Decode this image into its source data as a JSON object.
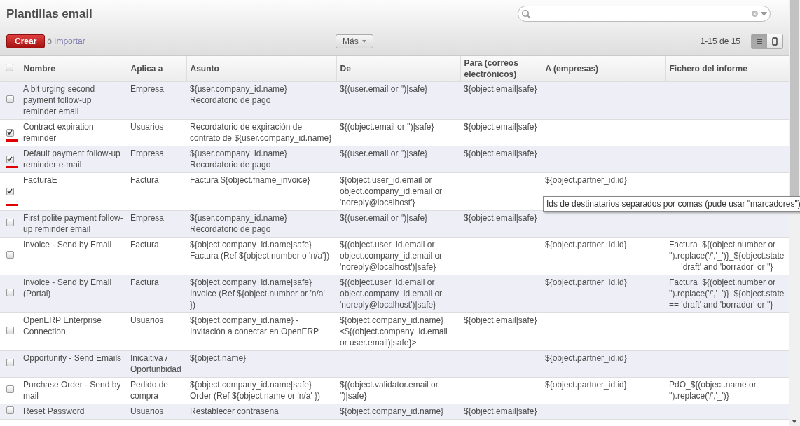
{
  "title": "Plantillas email",
  "select_all": false,
  "toolbar": {
    "create": "Crear",
    "or_import": "ó",
    "import": "Importar",
    "more": "Más",
    "pager": "1-15 de 15",
    "views": [
      {
        "kind": "list",
        "selected": true
      },
      {
        "kind": "form",
        "selected": false
      }
    ]
  },
  "table": {
    "columns": [
      "Nombre",
      "Aplica a",
      "Asunto",
      "De",
      "Para (correos electrónicos)",
      "A (empresas)",
      "Fichero del informe"
    ],
    "rows": [
      {
        "checked": false,
        "cells": [
          "A bit urging second payment follow-up reminder email",
          "Empresa",
          "${user.company_id.name} Recordatorio de pago",
          "${(user.email or '')|safe}",
          "${object.email|safe}",
          "",
          ""
        ]
      },
      {
        "checked": true,
        "cells": [
          "Contract expiration reminder",
          "Usuarios",
          "Recordatorio de expiración de contrato de ${user.company_id.name}",
          "${(object.email or '')|safe}",
          "${object.email|safe}",
          "",
          ""
        ]
      },
      {
        "checked": true,
        "cells": [
          "Default payment follow-up reminder e-mail",
          "Empresa",
          "${user.company_id.name} Recordatorio de pago",
          "${(user.email or '')|safe}",
          "${object.email|safe}",
          "",
          ""
        ]
      },
      {
        "checked": true,
        "cells": [
          "FacturaE",
          "Factura",
          "Factura ${object.fname_invoice}",
          "${object.user_id.email or object.company_id.email or 'noreply@localhost'}",
          "",
          "${object.partner_id.id}",
          ""
        ]
      },
      {
        "checked": false,
        "cells": [
          "First polite payment follow-up reminder email",
          "Empresa",
          "${user.company_id.name} Recordatorio de pago",
          "${(user.email or '')|safe}",
          "${object.email|safe}",
          "",
          ""
        ]
      },
      {
        "checked": false,
        "cells": [
          "Invoice - Send by Email",
          "Factura",
          "${object.company_id.name|safe} Factura (Ref ${object.number o 'n/a'})",
          "${(object.user_id.email or object.company_id.email or 'noreply@localhost')|safe}",
          "",
          "${object.partner_id.id}",
          "Factura_${(object.number or '').replace('/','_')}_${object.state == 'draft' and 'borrador' or ''}"
        ]
      },
      {
        "checked": false,
        "cells": [
          "Invoice - Send by Email (Portal)",
          "Factura",
          "${object.company_id.name|safe} Invoice (Ref ${object.number or 'n/a' })",
          "${(object.user_id.email or object.company_id.email or 'noreply@localhost')|safe}",
          "",
          "${object.partner_id.id}",
          "Factura_${(object.number or '').replace('/','_')}_${object.state == 'draft' and 'borrador' or ''}"
        ]
      },
      {
        "checked": false,
        "cells": [
          "OpenERP Enterprise Connection",
          "Usuarios",
          "${object.company_id.name} - Invitación a conectar en OpenERP",
          "${object.company_id.name} <${(object.company_id.email or user.email)|safe}>",
          "${object.email|safe}",
          "",
          ""
        ]
      },
      {
        "checked": false,
        "cells": [
          "Opportunity - Send Emails",
          "Inicaitiva / Oportunbidad",
          "${object.name}",
          "",
          "",
          "${object.partner_id.id}",
          ""
        ]
      },
      {
        "checked": false,
        "cells": [
          "Purchase Order - Send by mail",
          "Pedido de compra",
          "${object.company_id.name|safe} Order (Ref ${object.name or 'n/a' })",
          "${(object.validator.email or '')|safe}",
          "",
          "${object.partner_id.id}",
          "PdO_${(object.name or '').replace('/','_')}"
        ]
      },
      {
        "checked": false,
        "cells": [
          "Reset Password",
          "Usuarios",
          "Restablecer contraseña",
          "${object.company_id.name}",
          "${object.email|safe}",
          "",
          ""
        ]
      }
    ]
  },
  "tooltip": "Ids de destinatarios separados por comas (pude usar \"marcadores\")"
}
